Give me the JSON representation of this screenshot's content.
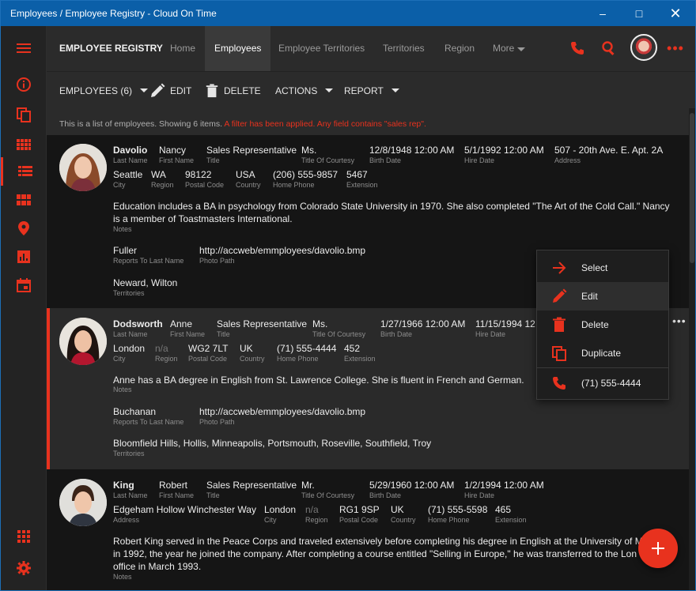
{
  "window": {
    "title": "Employees / Employee Registry - Cloud On Time"
  },
  "nav": {
    "brand": "EMPLOYEE REGISTRY",
    "tabs": [
      "Home",
      "Employees",
      "Employee Territories",
      "Territories",
      "Region",
      "More"
    ]
  },
  "toolbar": {
    "employees_label": "EMPLOYEES (6)",
    "edit_label": "EDIT",
    "delete_label": "DELETE",
    "actions_label": "ACTIONS",
    "report_label": "REPORT"
  },
  "info": {
    "text": "This is a list of employees. Showing 6 items.",
    "filter": "A filter has been applied. Any field contains \"sales rep\"."
  },
  "labels": {
    "last_name": "Last Name",
    "first_name": "First Name",
    "title": "Title",
    "title_of_courtesy": "Title Of Courtesy",
    "birth_date": "Birth Date",
    "hire_date": "Hire Date",
    "address": "Address",
    "city": "City",
    "region": "Region",
    "postal_code": "Postal Code",
    "country": "Country",
    "home_phone": "Home Phone",
    "extension": "Extension",
    "notes": "Notes",
    "reports_to": "Reports To Last Name",
    "photo_path": "Photo Path",
    "territories": "Territories"
  },
  "employees": [
    {
      "last_name": "Davolio",
      "first_name": "Nancy",
      "title": "Sales Representative",
      "courtesy": "Ms.",
      "birth_date": "12/8/1948 12:00 AM",
      "hire_date": "5/1/1992 12:00 AM",
      "address": "507 - 20th Ave. E. Apt. 2A",
      "city": "Seattle",
      "region": "WA",
      "postal_code": "98122",
      "country": "USA",
      "home_phone": "(206) 555-9857",
      "extension": "5467",
      "notes": "Education includes a BA in psychology from Colorado State University in 1970. She also completed \"The Art of the Cold Call.\" Nancy is a member of Toastmasters International.",
      "reports_to": "Fuller",
      "photo_path": "http://accweb/emmployees/davolio.bmp",
      "territories": "Neward, Wilton"
    },
    {
      "last_name": "Dodsworth",
      "first_name": "Anne",
      "title": "Sales Representative",
      "courtesy": "Ms.",
      "birth_date": "1/27/1966 12:00 AM",
      "hire_date": "11/15/1994 12",
      "city": "London",
      "region": "n/a",
      "postal_code": "WG2 7LT",
      "country": "UK",
      "home_phone": "(71) 555-4444",
      "extension": "452",
      "notes": "Anne has a BA degree in English from St. Lawrence College. She is fluent in French and German.",
      "reports_to": "Buchanan",
      "photo_path": "http://accweb/emmployees/davolio.bmp",
      "territories": "Bloomfield Hills, Hollis, Minneapolis, Portsmouth, Roseville, Southfield, Troy"
    },
    {
      "last_name": "King",
      "first_name": "Robert",
      "title": "Sales Representative",
      "courtesy": "Mr.",
      "birth_date": "5/29/1960 12:00 AM",
      "hire_date": "1/2/1994 12:00 AM",
      "address": "Edgeham Hollow Winchester Way",
      "city": "London",
      "region": "n/a",
      "postal_code": "RG1 9SP",
      "country": "UK",
      "home_phone": "(71) 555-5598",
      "extension": "465",
      "notes_line1": "Robert King served in the Peace Corps and traveled extensively before completing his degree in English at the University of M",
      "notes_line2": "in 1992, the year he joined the company. After completing a course entitled \"Selling in Europe,\" he was transferred to the Lon",
      "notes_line3": "office in March 1993."
    }
  ],
  "context_menu": {
    "items": [
      "Select",
      "Edit",
      "Delete",
      "Duplicate",
      "(71) 555-4444"
    ]
  },
  "colors": {
    "accent": "#e8321e",
    "titlebar": "#0b5fa8",
    "panel": "#2b2b2b",
    "background": "#151515"
  }
}
